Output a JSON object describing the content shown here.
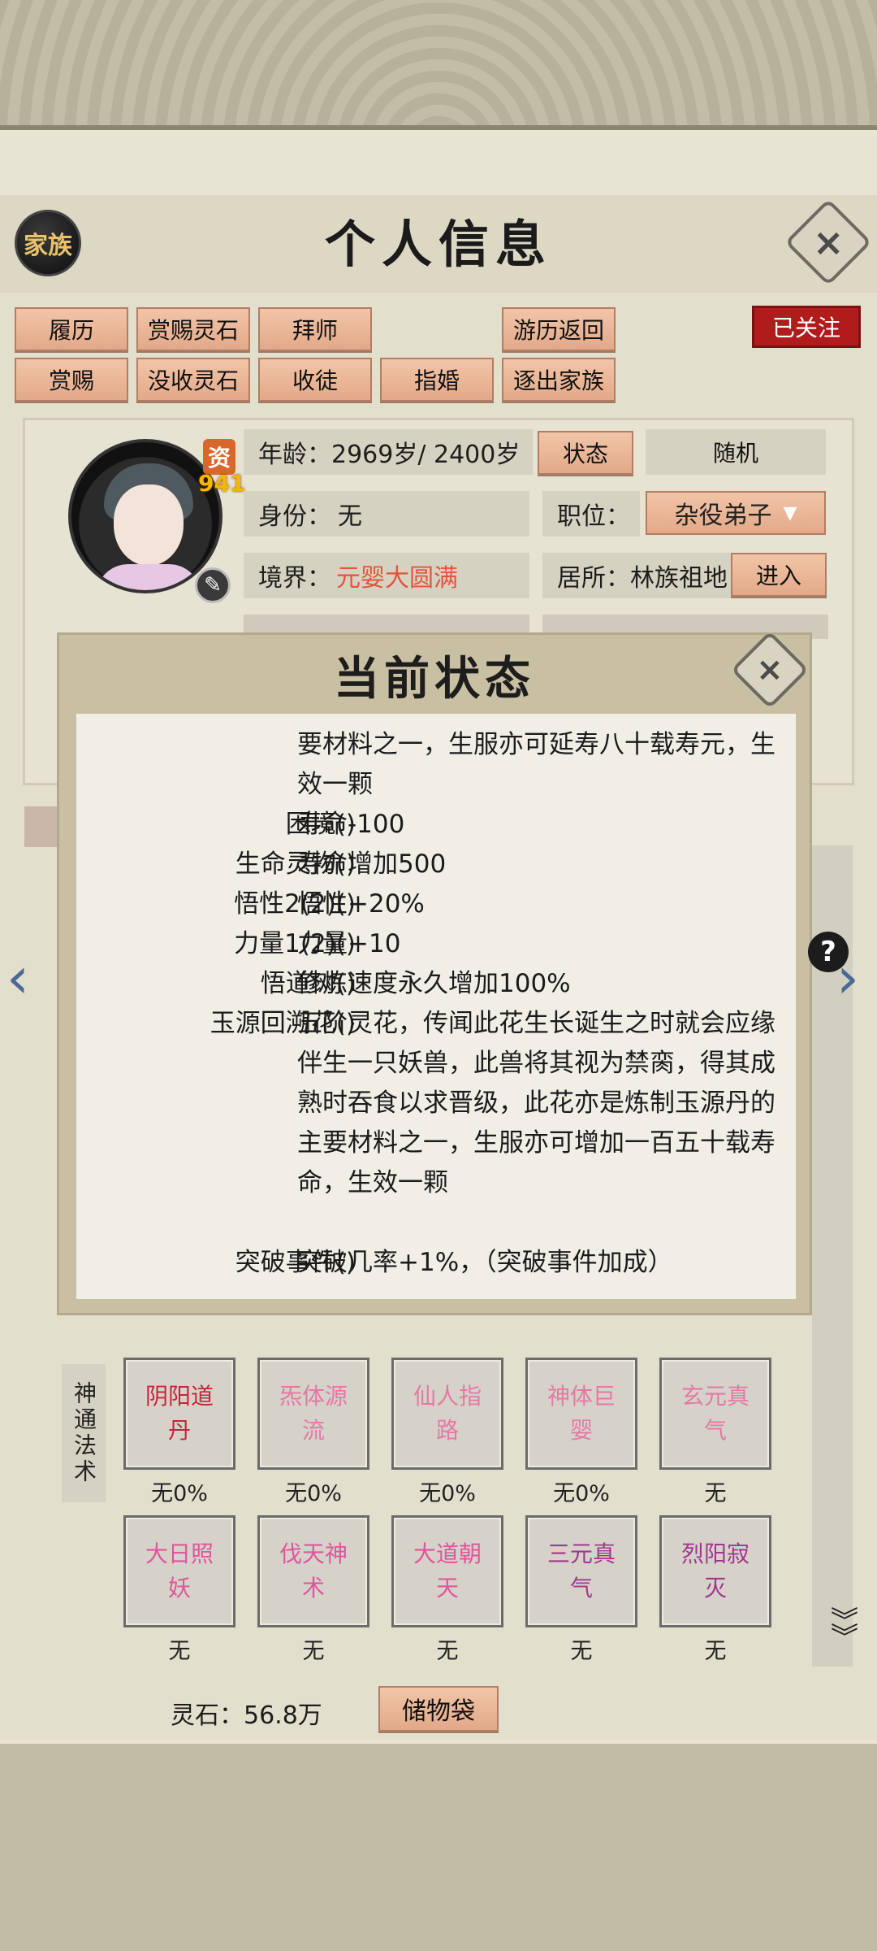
{
  "header": {
    "title": "个人信息",
    "family_label": "家族"
  },
  "action_buttons_row1": [
    "履历",
    "赏赐灵石",
    "拜师",
    "游历返回"
  ],
  "action_buttons_row2": [
    "赏赐",
    "没收灵石",
    "收徒",
    "指婚",
    "逐出家族"
  ],
  "followed_label": "已关注",
  "profile": {
    "talent_label": "资",
    "talent_value": "941",
    "age": "年龄：2969岁/ 2400岁",
    "status_button": "状态",
    "random_button": "随机",
    "identity_label": "身份：",
    "identity_value": "无",
    "position_label": "职位：",
    "position_value": "杂役弟子",
    "realm_label": "境界：",
    "realm_value": "元婴大圆满",
    "residence": "居所：林族祖地",
    "enter_button": "进入"
  },
  "dialog": {
    "title": "当前状态",
    "rows": [
      {
        "key": "",
        "value": "要材料之一，生服亦可延寿八十载寿元，生效一颗"
      },
      {
        "key": "困境()",
        "value": "寿命-100"
      },
      {
        "key": "生命灵物()",
        "value": "寿命增加500"
      },
      {
        "key": "悟性2(2)()",
        "value": "悟性+20%"
      },
      {
        "key": "力量1(2)()",
        "value": "力量+10"
      },
      {
        "key": "悟道树()",
        "value": "修炼速度永久增加100%"
      },
      {
        "key": "玉源回溯花()",
        "value": "五阶灵花，传闻此花生长诞生之时就会应缘伴生一只妖兽，此兽将其视为禁脔，得其成熟时吞食以求晋级，此花亦是炼制玉源丹的主要材料之一，生服亦可增加一百五十载寿命，生效一颗"
      },
      {
        "key": "突破事件()",
        "value": "突破几率+1%，（突破事件加成）"
      }
    ]
  },
  "skills": {
    "label": "神通法术",
    "items": [
      {
        "name": "阴阳道丹",
        "sub": "无0%",
        "color": "#c8233a"
      },
      {
        "name": "炁体源流",
        "sub": "无0%",
        "color": "#e27aa6"
      },
      {
        "name": "仙人指路",
        "sub": "无0%",
        "color": "#e27aa6"
      },
      {
        "name": "神体巨婴",
        "sub": "无0%",
        "color": "#e27aa6"
      },
      {
        "name": "玄元真气",
        "sub": "无",
        "color": "#e27aa6"
      },
      {
        "name": "大日照妖",
        "sub": "无",
        "color": "#e0559c"
      },
      {
        "name": "伐天神术",
        "sub": "无",
        "color": "#e0559c"
      },
      {
        "name": "大道朝天",
        "sub": "无",
        "color": "#e0559c"
      },
      {
        "name": "三元真气",
        "sub": "无",
        "color": "#a2368f"
      },
      {
        "name": "烈阳寂灭",
        "sub": "无",
        "color": "#a2368f"
      }
    ]
  },
  "footer": {
    "spirit_stone": "灵石：56.8万",
    "bag_button": "储物袋"
  },
  "icons": [
    "close-icon",
    "edit-icon",
    "help-icon",
    "arrow-left-icon",
    "arrow-right-icon",
    "expand-down-icon",
    "chevron-down-icon"
  ]
}
